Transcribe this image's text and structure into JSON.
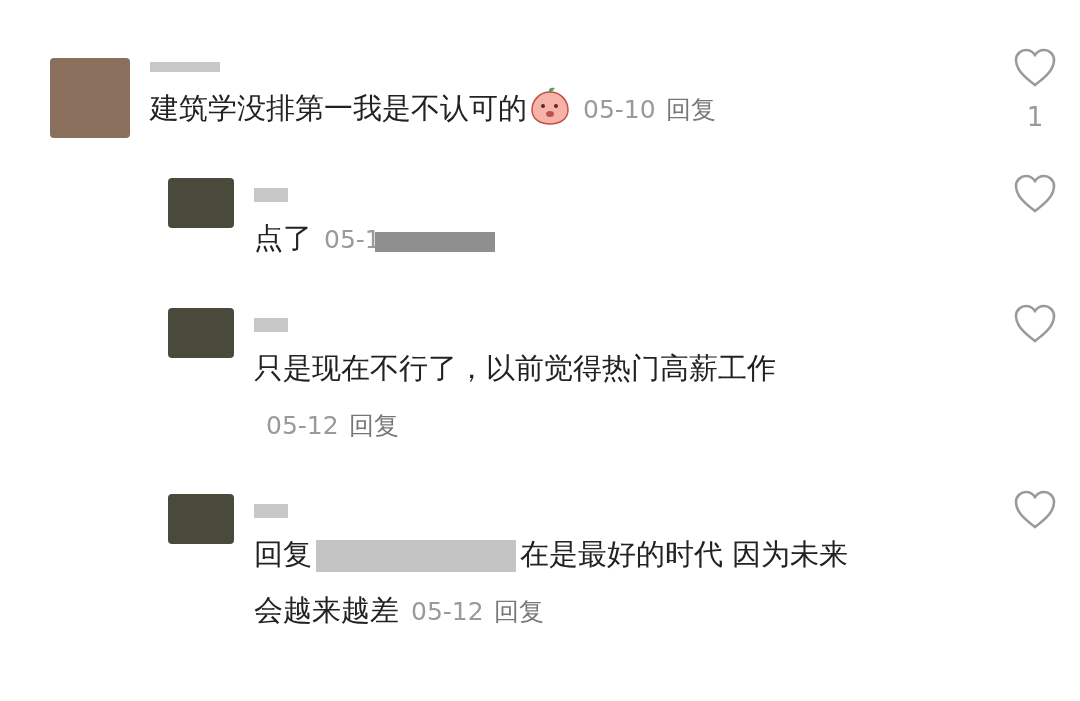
{
  "comments": [
    {
      "text": "建筑学没排第一我是不认可的",
      "emoji": true,
      "date": "05-10",
      "reply_label": "回复",
      "like_count": "1",
      "liked": false,
      "children": [
        {
          "text": "点了",
          "date": "05-1",
          "date_redacted": true,
          "liked": false
        },
        {
          "text": "只是现在不行了，以前觉得热门高薪工作",
          "date": "05-12",
          "reply_label": "回复",
          "liked": false
        },
        {
          "reply_prefix": "回复",
          "lines": [
            "在是最好的时代 因为未来",
            "会越来越差"
          ],
          "date": "05-12",
          "reply_label": "回复",
          "liked": false
        }
      ]
    }
  ]
}
